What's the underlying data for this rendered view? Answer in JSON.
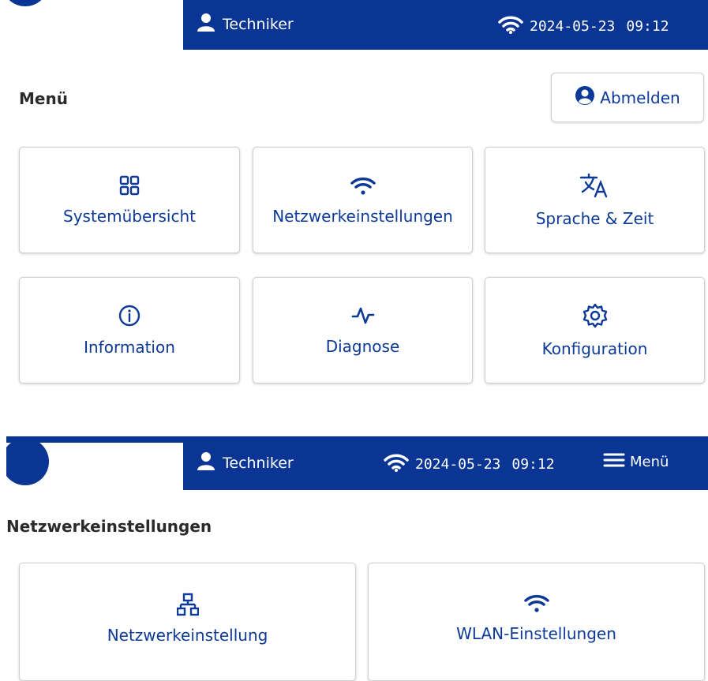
{
  "screen_top": {
    "header": {
      "user": "Techniker",
      "date": "2024-05-23",
      "time": "09:12"
    },
    "title": "Menü",
    "logout_label": "Abmelden",
    "tiles": [
      {
        "label": "Systemübersicht",
        "icon": "grid-icon"
      },
      {
        "label": "Netzwerkeinstellungen",
        "icon": "wifi-icon"
      },
      {
        "label": "Sprache & Zeit",
        "icon": "translate-icon"
      },
      {
        "label": "Information",
        "icon": "info-icon"
      },
      {
        "label": "Diagnose",
        "icon": "pulse-icon"
      },
      {
        "label": "Konfiguration",
        "icon": "gear-icon"
      }
    ]
  },
  "screen_bottom": {
    "header": {
      "user": "Techniker",
      "date": "2024-05-23",
      "time": "09:12",
      "menu_label": "Menü"
    },
    "title": "Netzwerkeinstellungen",
    "tiles": [
      {
        "label": "Netzwerkeinstellung",
        "icon": "network-icon"
      },
      {
        "label": "WLAN-Einstellungen",
        "icon": "wifi-icon"
      }
    ]
  },
  "colors": {
    "header_bg": "#0a3595",
    "accent": "#0d3a96",
    "border": "#cfcfcf"
  }
}
